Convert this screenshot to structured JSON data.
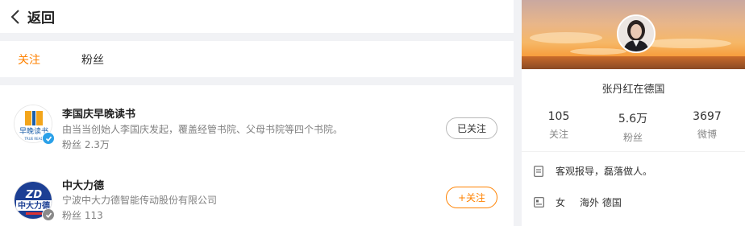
{
  "header": {
    "back_label": "返回"
  },
  "tabs": [
    {
      "label": "关注",
      "active": true
    },
    {
      "label": "粉丝",
      "active": false
    }
  ],
  "accent": "#ff8200",
  "follows": [
    {
      "name": "李国庆早晚读书",
      "desc": "由当当创始人李国庆发起，覆盖经管书院、父母书院等四个书院。",
      "fans": "粉丝 2.3万",
      "button": "已关注",
      "verified": "blue",
      "avatar_text": "早晚读书",
      "avatar_sub": "TRUE READ"
    },
    {
      "name": "中大力德",
      "desc": "宁波中大力德智能传动股份有限公司",
      "fans": "粉丝 113",
      "button": "+关注",
      "verified": "gray",
      "avatar_text": "中大力德",
      "avatar_logo": "ZD"
    }
  ],
  "profile": {
    "name": "张丹红在德国",
    "stats": [
      {
        "num": "105",
        "label": "关注"
      },
      {
        "num": "5.6万",
        "label": "粉丝"
      },
      {
        "num": "3697",
        "label": "微博"
      }
    ],
    "bio": "客观报导，磊落做人。",
    "gender": "女",
    "location": "海外 德国"
  }
}
